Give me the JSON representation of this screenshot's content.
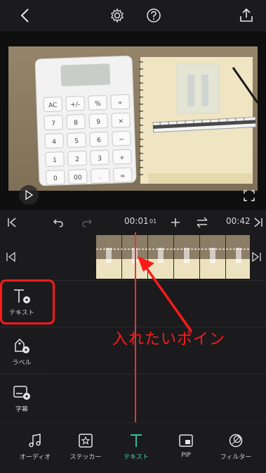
{
  "topbar": {
    "back_icon": "chevron-left-icon",
    "settings_icon": "gear-icon",
    "help_icon": "help-icon",
    "share_icon": "share-icon"
  },
  "timeline": {
    "current_time": "00:01",
    "current_frame": "01",
    "total_time": "00:42"
  },
  "side_panel": {
    "items": [
      {
        "label": "テキスト",
        "icon": "text-add-icon"
      },
      {
        "label": "ラベル",
        "icon": "label-add-icon"
      },
      {
        "label": "字幕",
        "icon": "subtitle-add-icon"
      }
    ]
  },
  "annotation": {
    "text": "入れたいポイン",
    "color": "#ff1a1a"
  },
  "bottom_toolbar": {
    "items": [
      {
        "label": "オーディオ",
        "icon": "music-note-icon"
      },
      {
        "label": "ステッカー",
        "icon": "sticker-icon"
      },
      {
        "label": "テキスト",
        "icon": "text-icon"
      },
      {
        "label": "PIP",
        "icon": "pip-icon"
      },
      {
        "label": "フィルター",
        "icon": "filter-icon"
      }
    ],
    "active_index": 2,
    "accent": "#3fd6a6"
  },
  "calculator": {
    "keys": [
      "AC",
      "+/-",
      "%",
      "÷",
      "7",
      "8",
      "9",
      "×",
      "4",
      "5",
      "6",
      "−",
      "1",
      "2",
      "3",
      "+",
      "0",
      "00",
      ".",
      "="
    ]
  }
}
